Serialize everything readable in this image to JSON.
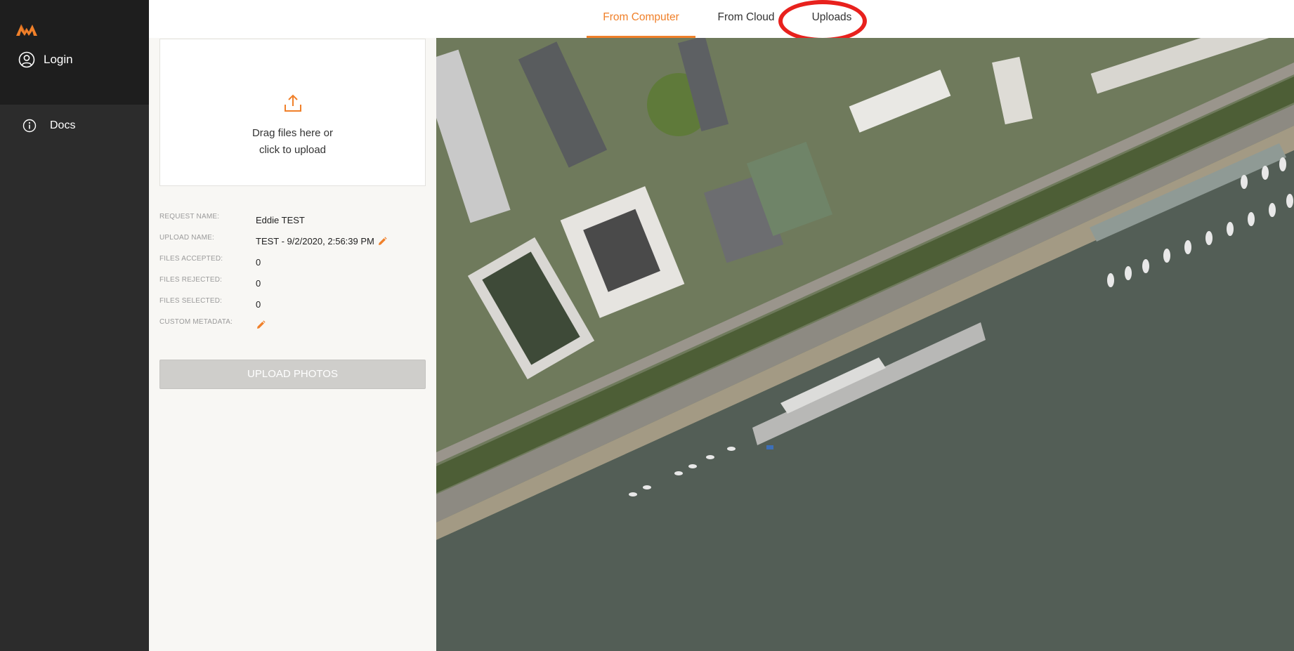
{
  "sidebar": {
    "login_label": "Login",
    "docs_label": "Docs"
  },
  "tabs": [
    {
      "label": "From Computer",
      "active": true
    },
    {
      "label": "From Cloud",
      "active": false
    },
    {
      "label": "Uploads",
      "active": false
    }
  ],
  "dropzone": {
    "line1": "Drag files here or",
    "line2": "click to upload"
  },
  "meta": {
    "request_name_label": "REQUEST NAME:",
    "request_name_value": "Eddie TEST",
    "upload_name_label": "UPLOAD NAME:",
    "upload_name_value": "TEST - 9/2/2020, 2:56:39 PM",
    "files_accepted_label": "FILES ACCEPTED:",
    "files_accepted_value": "0",
    "files_rejected_label": "FILES REJECTED:",
    "files_rejected_value": "0",
    "files_selected_label": "FILES SELECTED:",
    "files_selected_value": "0",
    "custom_metadata_label": "CUSTOM METADATA:"
  },
  "upload_button_label": "UPLOAD PHOTOS",
  "colors": {
    "accent": "#f0802a",
    "sidebar_bg": "#2c2c2c",
    "sidebar_top_bg": "#1e1e1e",
    "panel_bg": "#f8f7f4",
    "button_disabled": "#cfcecb",
    "highlight_ring": "#e8211d",
    "water": "#535e56"
  },
  "icons": {
    "logo": "brand-logo",
    "login": "user-circle-icon",
    "docs": "info-circle-icon",
    "upload": "upload-icon",
    "edit": "pencil-icon"
  }
}
